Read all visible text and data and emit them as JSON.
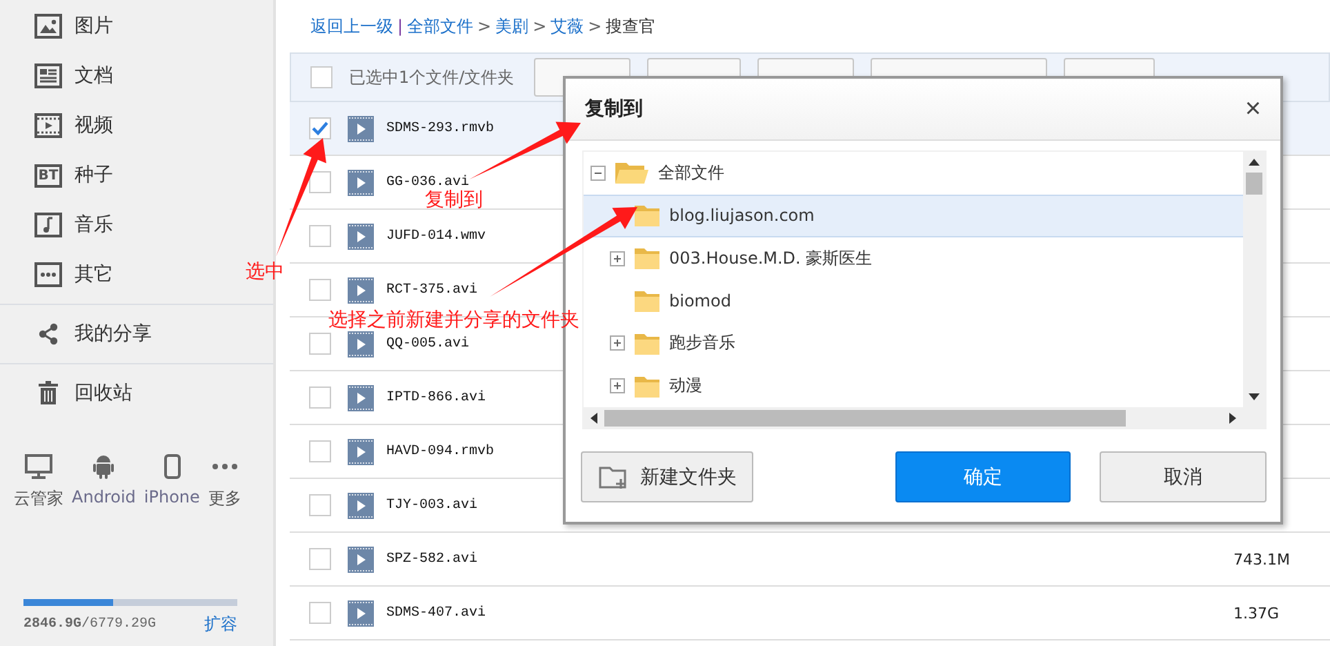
{
  "sidebar": {
    "nav": [
      {
        "label": "图片"
      },
      {
        "label": "文档"
      },
      {
        "label": "视频"
      },
      {
        "label": "种子",
        "badge": "BT"
      },
      {
        "label": "音乐"
      },
      {
        "label": "其它"
      }
    ],
    "share": {
      "label": "我的分享"
    },
    "trash": {
      "label": "回收站"
    },
    "devices": [
      {
        "label": "云管家"
      },
      {
        "label": "Android"
      },
      {
        "label": "iPhone"
      },
      {
        "label": "更多"
      }
    ],
    "storage": {
      "level": 0.42,
      "text": "**2846.9G**/6779.29G",
      "expand_link": "扩容"
    }
  },
  "breadcrumb": {
    "back": "返回上一级",
    "divider": "|",
    "separator": ">",
    "path": [
      {
        "label": "全部文件",
        "current": false
      },
      {
        "label": "美剧",
        "current": false
      },
      {
        "label": "艾薇",
        "current": false
      },
      {
        "label": "搜查官",
        "current": true
      }
    ]
  },
  "toolbar": {
    "select_all": {
      "checked": false
    },
    "selection_text": "已选中1个文件/文件夹"
  },
  "files": [
    {
      "name": "SDMS-293.rmvb",
      "selected": true
    },
    {
      "name": "GG-036.avi",
      "selected": false
    },
    {
      "name": "JUFD-014.wmv",
      "selected": false
    },
    {
      "name": "RCT-375.avi",
      "selected": false
    },
    {
      "name": "QQ-005.avi",
      "selected": false
    },
    {
      "name": "IPTD-866.avi",
      "selected": false
    },
    {
      "name": "HAVD-094.rmvb",
      "selected": false
    },
    {
      "name": "TJY-003.avi",
      "selected": false
    },
    {
      "name": "SPZ-582.avi",
      "selected": false,
      "size": "743.1M"
    },
    {
      "name": "SDMS-407.avi",
      "selected": false,
      "size": "1.37G"
    }
  ],
  "dialog": {
    "title": "复制到",
    "close": "×",
    "tree": {
      "label": "全部文件",
      "expanded": true,
      "children": [
        {
          "label": "blog.liujason.com",
          "selected": true,
          "expandable": false
        },
        {
          "label": "003.House.M.D. 豪斯医生",
          "selected": false,
          "expandable": true
        },
        {
          "label": "biomod",
          "selected": false,
          "expandable": false
        },
        {
          "label": "跑步音乐",
          "selected": false,
          "expandable": true
        },
        {
          "label": "动漫",
          "selected": false,
          "expandable": true
        }
      ]
    },
    "buttons": {
      "new_folder": "新建文件夹",
      "confirm": "确定",
      "cancel": "取消"
    }
  },
  "annotations": [
    {
      "text": "选中"
    },
    {
      "text": "复制到"
    },
    {
      "text": "选择之前新建并分享的文件夹"
    }
  ]
}
